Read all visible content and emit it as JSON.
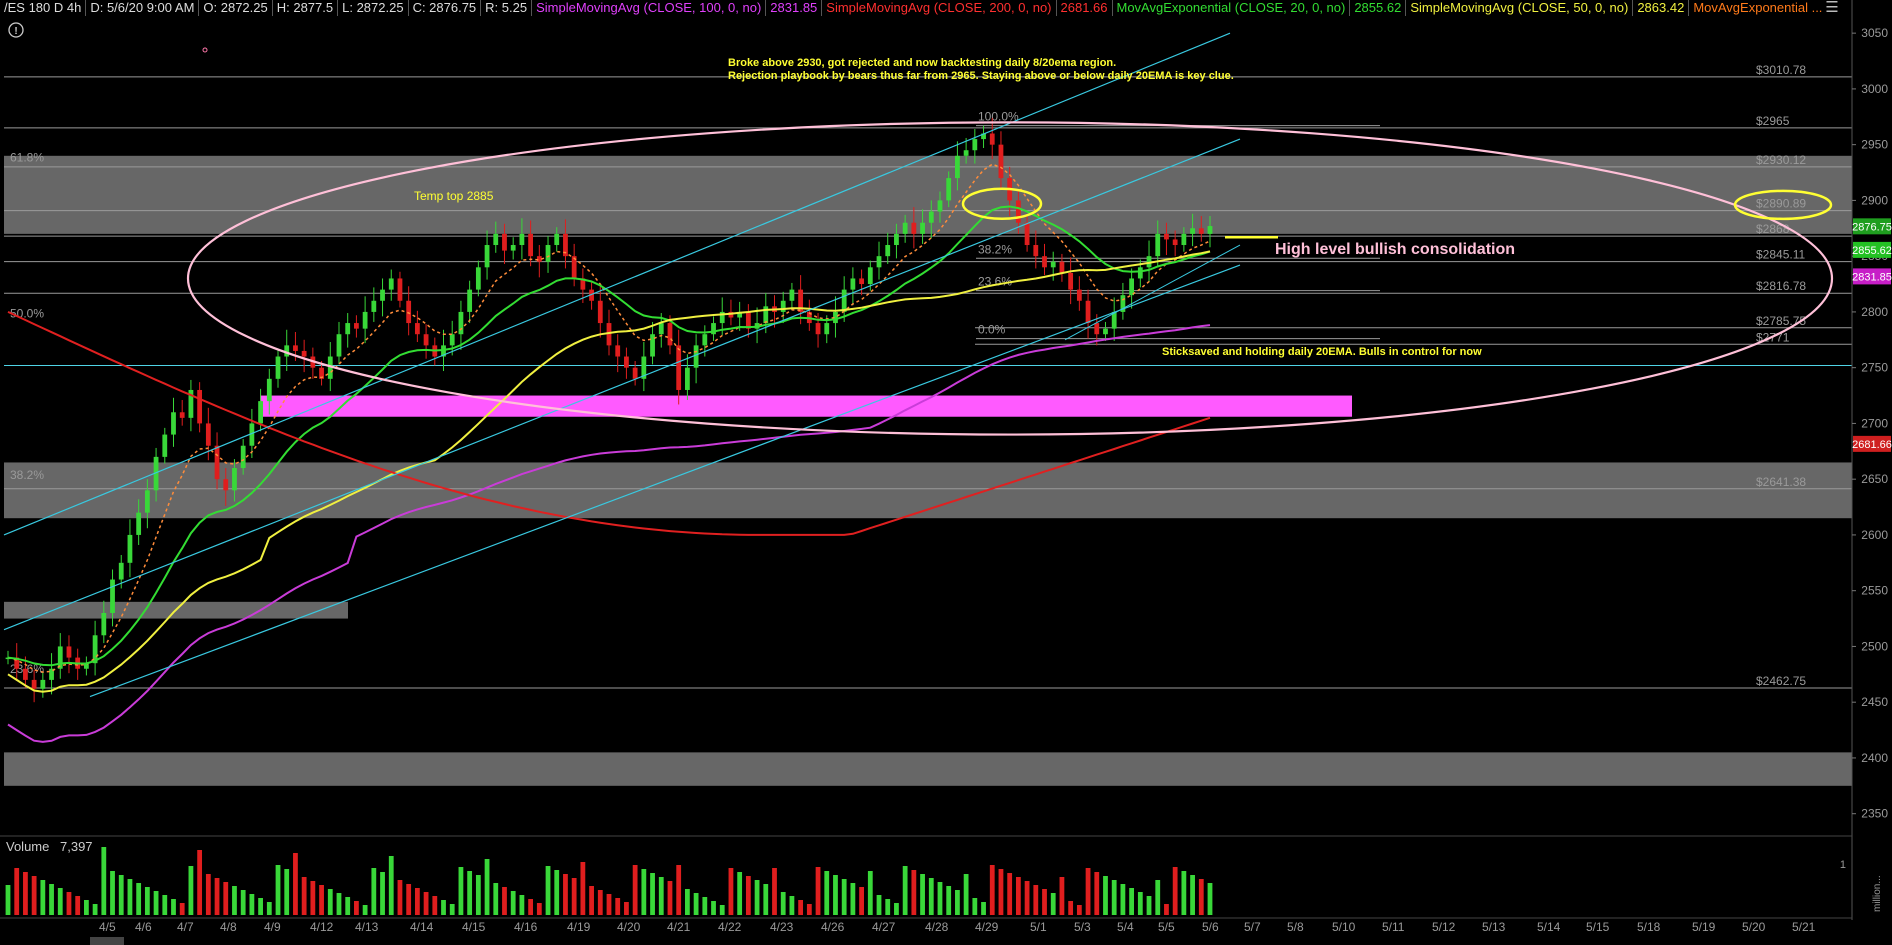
{
  "header": {
    "symbol": "/ES 180 D 4h",
    "date": "D: 5/6/20 9:00 AM",
    "ohlc": {
      "open": "O: 2872.25",
      "high": "H: 2877.5",
      "low": "L: 2872.25",
      "close": "C: 2876.75",
      "range": "R: 5.25"
    },
    "studies": [
      {
        "label": "SimpleMovingAvg (CLOSE, 100, 0, no)",
        "value": "2831.85",
        "color": "#e040fb"
      },
      {
        "label": "SimpleMovingAvg (CLOSE, 200, 0, no)",
        "value": "2681.66",
        "color": "#ff3030"
      },
      {
        "label": "MovAvgExponential (CLOSE, 20, 0, no)",
        "value": "2855.62",
        "color": "#33dd33"
      },
      {
        "label": "SimpleMovingAvg (CLOSE, 50, 0, no)",
        "value": "2863.42",
        "color": "#f0f040"
      },
      {
        "label": "MovAvgExponential ...",
        "value": "",
        "color": "#ff7a1a"
      }
    ],
    "info_icon": "info-icon"
  },
  "annotations": {
    "note1": "Broke above 2930, got rejected and now backtesting daily 8/20ema region.",
    "note2": "Rejection playbook by bears thus far from 2965. Staying above or below daily 20EMA is key clue.",
    "temp_top": "Temp  top 2885",
    "consolidation": "High level bullish consolidation",
    "sticksaved": "Sticksaved and holding daily 20EMA. Bulls in control for now"
  },
  "level_labels": [
    "$3010.78",
    "$2965",
    "$2930.12",
    "$2890.89",
    "$2868",
    "$2845.11",
    "$2816.78",
    "$2785.75",
    "$2771",
    "$2641.38",
    "$2462.75"
  ],
  "fib_left": [
    "61.8%",
    "50.0%",
    "38.2%",
    "23.6%"
  ],
  "fib_right": [
    "100.0%",
    "38.2%",
    "23.6%",
    "0.0%"
  ],
  "price_badges": [
    {
      "value": "2876.75",
      "color": "#1f9e1f"
    },
    {
      "value": "2855.62",
      "color": "#23c123"
    },
    {
      "value": "2831.85",
      "color": "#c71ec7"
    },
    {
      "value": "2681.66",
      "color": "#cf1f1f"
    }
  ],
  "volume": {
    "label": "Volume",
    "value": "7,397",
    "scale_label": "1",
    "unit": "million..."
  },
  "chart_data": {
    "type": "candlestick",
    "title": "",
    "ylim": [
      2330,
      3060
    ],
    "y_ticks": [
      2350,
      2400,
      2450,
      2500,
      2550,
      2600,
      2650,
      2700,
      2750,
      2800,
      2850,
      2900,
      2950,
      3000,
      3050
    ],
    "x_ticks": [
      "4/5",
      "4/6",
      "4/7",
      "4/8",
      "4/9",
      "4/12",
      "4/13",
      "4/14",
      "4/15",
      "4/16",
      "4/19",
      "4/20",
      "4/21",
      "4/22",
      "4/23",
      "4/26",
      "4/27",
      "4/28",
      "4/29",
      "5/1",
      "5/3",
      "5/4",
      "5/5",
      "5/6",
      "5/7",
      "5/8",
      "5/10",
      "5/11",
      "5/12",
      "5/13",
      "5/14",
      "5/15",
      "5/18",
      "5/19",
      "5/20",
      "5/21"
    ],
    "close_path": [
      2490,
      2480,
      2470,
      2462,
      2470,
      2480,
      2500,
      2490,
      2480,
      2485,
      2510,
      2530,
      2560,
      2575,
      2600,
      2620,
      2640,
      2670,
      2690,
      2710,
      2705,
      2730,
      2700,
      2680,
      2650,
      2640,
      2660,
      2680,
      2700,
      2720,
      2740,
      2760,
      2770,
      2765,
      2760,
      2750,
      2740,
      2760,
      2780,
      2790,
      2785,
      2800,
      2810,
      2820,
      2830,
      2810,
      2790,
      2780,
      2770,
      2760,
      2770,
      2780,
      2800,
      2820,
      2840,
      2860,
      2870,
      2855,
      2860,
      2870,
      2850,
      2845,
      2860,
      2870,
      2850,
      2830,
      2820,
      2810,
      2790,
      2770,
      2760,
      2750,
      2740,
      2760,
      2780,
      2790,
      2770,
      2730,
      2750,
      2770,
      2780,
      2790,
      2800,
      2795,
      2800,
      2785,
      2790,
      2805,
      2800,
      2810,
      2820,
      2800,
      2790,
      2780,
      2790,
      2800,
      2820,
      2830,
      2825,
      2840,
      2850,
      2860,
      2870,
      2880,
      2870,
      2880,
      2890,
      2900,
      2920,
      2940,
      2945,
      2955,
      2960,
      2950,
      2920,
      2900,
      2880,
      2860,
      2850,
      2840,
      2845,
      2835,
      2820,
      2810,
      2790,
      2780,
      2785,
      2800,
      2815,
      2830,
      2840,
      2850,
      2870,
      2865,
      2860,
      2870,
      2875,
      2870,
      2877
    ],
    "series": [
      {
        "name": "SimpleMovingAvg (CLOSE, 100, 0, no)",
        "last": 2831.85
      },
      {
        "name": "SimpleMovingAvg (CLOSE, 200, 0, no)",
        "last": 2681.66
      },
      {
        "name": "MovAvgExponential (CLOSE, 20, 0, no)",
        "last": 2855.62
      },
      {
        "name": "SimpleMovingAvg (CLOSE, 50, 0, no)",
        "last": 2863.42
      }
    ],
    "horizontal_levels": [
      3010.78,
      2965,
      2930.12,
      2890.89,
      2868,
      2845.11,
      2816.78,
      2785.75,
      2771,
      2641.38,
      2462.75
    ],
    "volume_max": 1.0
  }
}
